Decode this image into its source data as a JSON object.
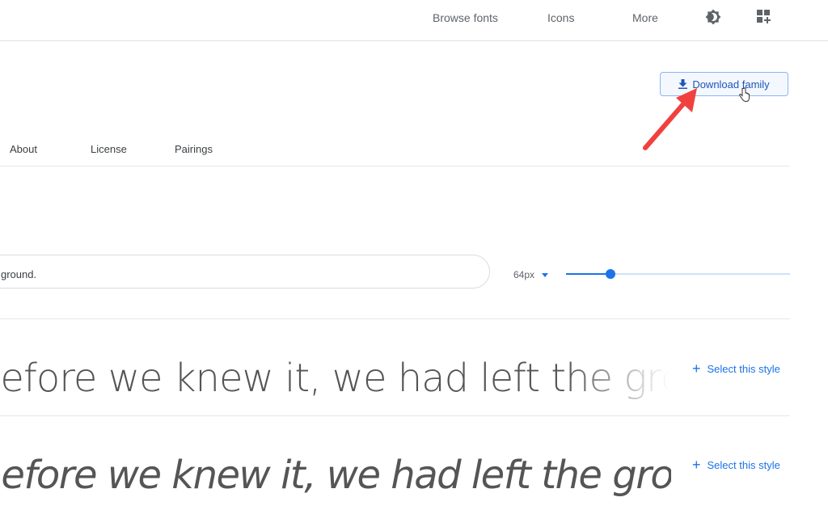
{
  "header": {
    "nav": [
      "Browse fonts",
      "Icons",
      "More"
    ],
    "icons": [
      "theme-toggle-icon",
      "selected-families-icon"
    ]
  },
  "download": {
    "label": "Download family",
    "icon": "download-icon"
  },
  "tabs": [
    "About",
    "License",
    "Pairings"
  ],
  "preview": {
    "text": "ground.",
    "size": "64px",
    "size_percent": 20
  },
  "styles": [
    {
      "sample": "Before we knew it, we had left the ground.",
      "action": "Select this style"
    },
    {
      "sample": "Before we knew it, we had left the ground.",
      "action": "Select this style"
    }
  ],
  "colors": {
    "accent": "#1a73e8",
    "annotation_arrow": "#f0413f"
  }
}
